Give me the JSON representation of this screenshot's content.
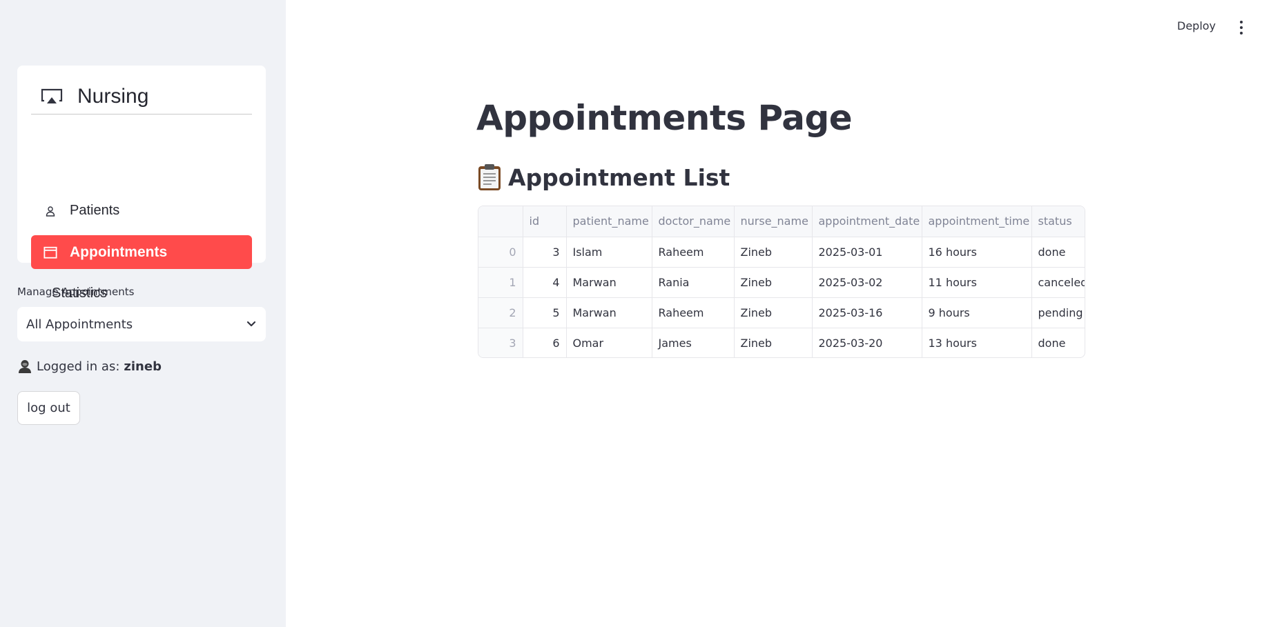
{
  "sidebar": {
    "menu": {
      "title": "Nursing",
      "items": [
        {
          "label": "Patients",
          "icon": "person-icon"
        },
        {
          "label": "Appointments",
          "icon": "calendar-icon",
          "active": true
        },
        {
          "label": "Statistics"
        }
      ]
    },
    "manage_label": "Manage Appointments",
    "select_value": "All Appointments",
    "logged_in_prefix": "Logged in as:",
    "username": "zineb",
    "logout_label": "log out"
  },
  "header": {
    "deploy_label": "Deploy"
  },
  "main": {
    "title": "Appointments Page",
    "section_title": "Appointment List",
    "table": {
      "columns": [
        "",
        "id",
        "patient_name",
        "doctor_name",
        "nurse_name",
        "appointment_date",
        "appointment_time",
        "status"
      ],
      "rows": [
        {
          "index": "0",
          "id": "3",
          "patient_name": "Islam",
          "doctor_name": "Raheem",
          "nurse_name": "Zineb",
          "appointment_date": "2025-03-01",
          "appointment_time": "16 hours",
          "status": "done"
        },
        {
          "index": "1",
          "id": "4",
          "patient_name": "Marwan",
          "doctor_name": "Rania",
          "nurse_name": "Zineb",
          "appointment_date": "2025-03-02",
          "appointment_time": "11 hours",
          "status": "canceled"
        },
        {
          "index": "2",
          "id": "5",
          "patient_name": "Marwan",
          "doctor_name": "Raheem",
          "nurse_name": "Zineb",
          "appointment_date": "2025-03-16",
          "appointment_time": "9 hours",
          "status": "pending"
        },
        {
          "index": "3",
          "id": "6",
          "patient_name": "Omar",
          "doctor_name": "James",
          "nurse_name": "Zineb",
          "appointment_date": "2025-03-20",
          "appointment_time": "13 hours",
          "status": "done"
        }
      ]
    }
  },
  "colors": {
    "accent": "#ff4b4b",
    "sidebar_bg": "#f0f2f6",
    "text": "#31333f"
  }
}
